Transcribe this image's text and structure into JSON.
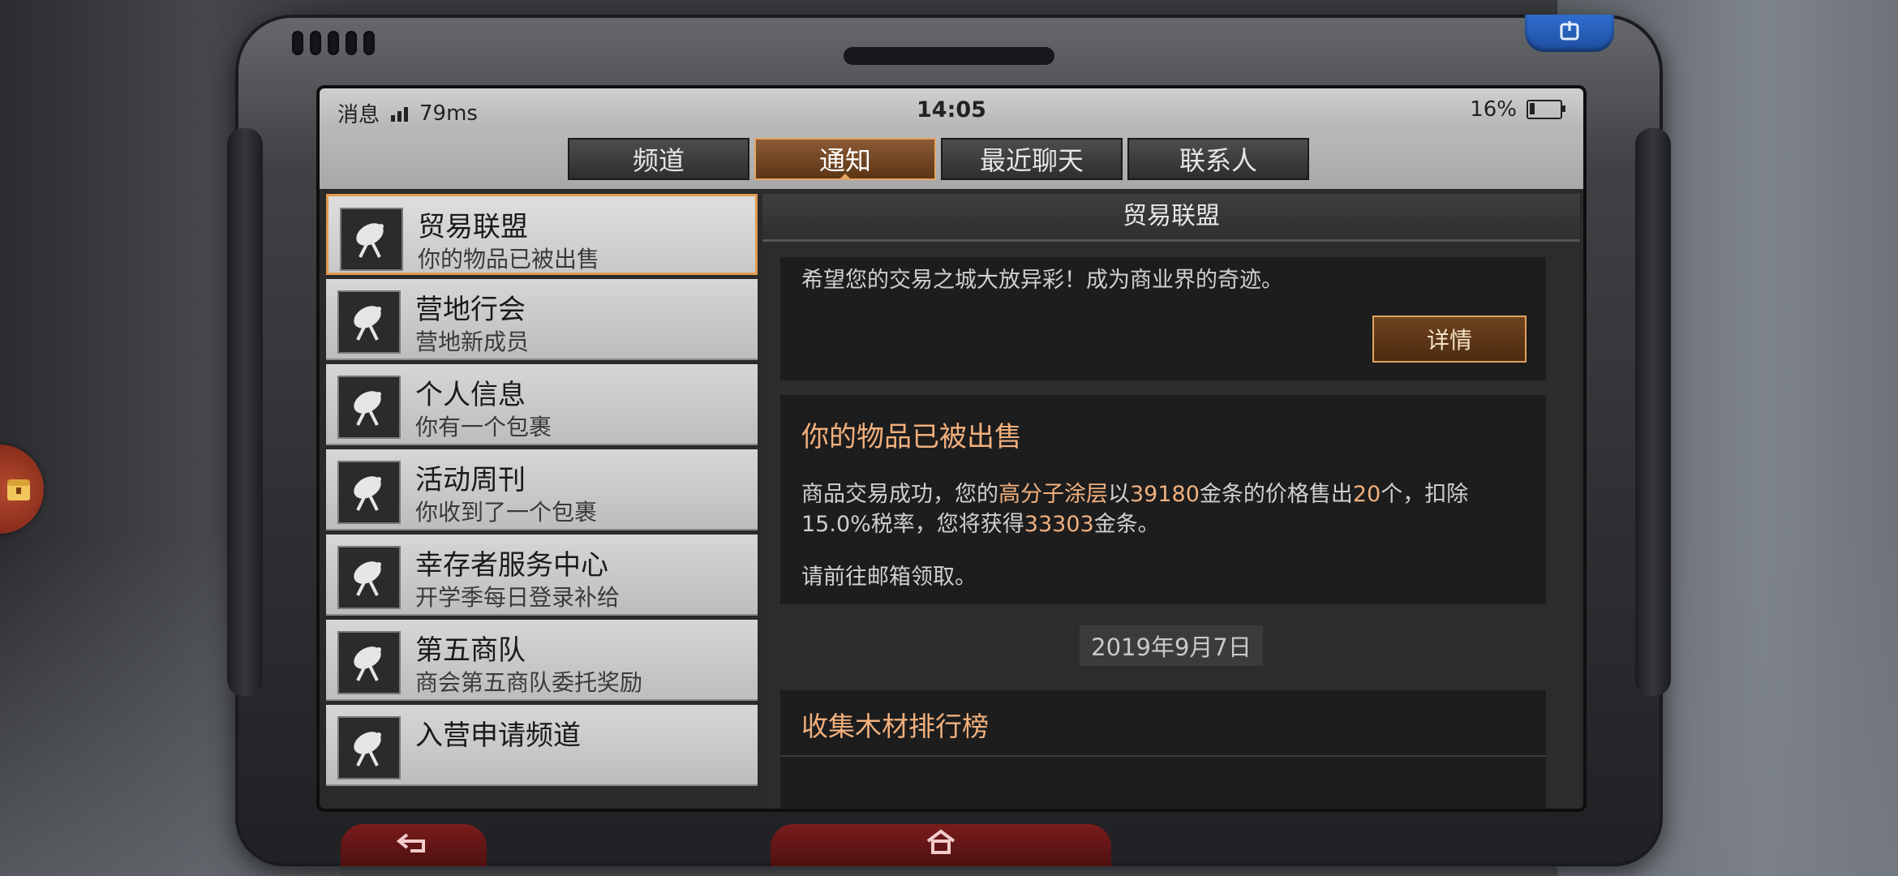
{
  "status_bar": {
    "left_label": "消息",
    "latency": "79ms",
    "time": "14:05",
    "battery": "16%"
  },
  "tabs": [
    {
      "label": "频道",
      "active": false
    },
    {
      "label": "通知",
      "active": true
    },
    {
      "label": "最近聊天",
      "active": false
    },
    {
      "label": "联系人",
      "active": false
    }
  ],
  "notifications": [
    {
      "title": "贸易联盟",
      "subtitle": "你的物品已被出售",
      "icon": "satellite-dish-icon",
      "active": true
    },
    {
      "title": "营地行会",
      "subtitle": "营地新成员",
      "icon": "satellite-dish-icon"
    },
    {
      "title": "个人信息",
      "subtitle": "你有一个包裹",
      "icon": "satellite-dish-icon"
    },
    {
      "title": "活动周刊",
      "subtitle": "你收到了一个包裹",
      "icon": "satellite-dish-icon"
    },
    {
      "title": "幸存者服务中心",
      "subtitle": "开学季每日登录补给",
      "icon": "satellite-dish-icon"
    },
    {
      "title": "第五商队",
      "subtitle": "商会第五商队委托奖励",
      "icon": "satellite-dish-icon"
    },
    {
      "title": "入营申请频道",
      "subtitle": "",
      "icon": "satellite-dish-icon"
    }
  ],
  "detail": {
    "header": "贸易联盟",
    "card1_text": "希望您的交易之城大放异彩！成为商业界的奇迹。",
    "details_button": "详情",
    "card2": {
      "title": "你的物品已被出售",
      "p_a": "商品交易成功，您的",
      "item": "高分子涂层",
      "p_b": "以",
      "price": "39180",
      "p_c": "金条的价格售出",
      "qty": "20",
      "p_d": "个，扣除15.0%税率，您将获得",
      "earn": "33303",
      "p_e": "金条。",
      "footer": "请前往邮箱领取。"
    },
    "date": "2019年9月7日",
    "card3_title": "收集木材排行榜"
  },
  "icons": {
    "power": "power-icon",
    "back": "back-arrow-icon",
    "home": "home-icon",
    "chest": "treasure-chest-icon"
  }
}
